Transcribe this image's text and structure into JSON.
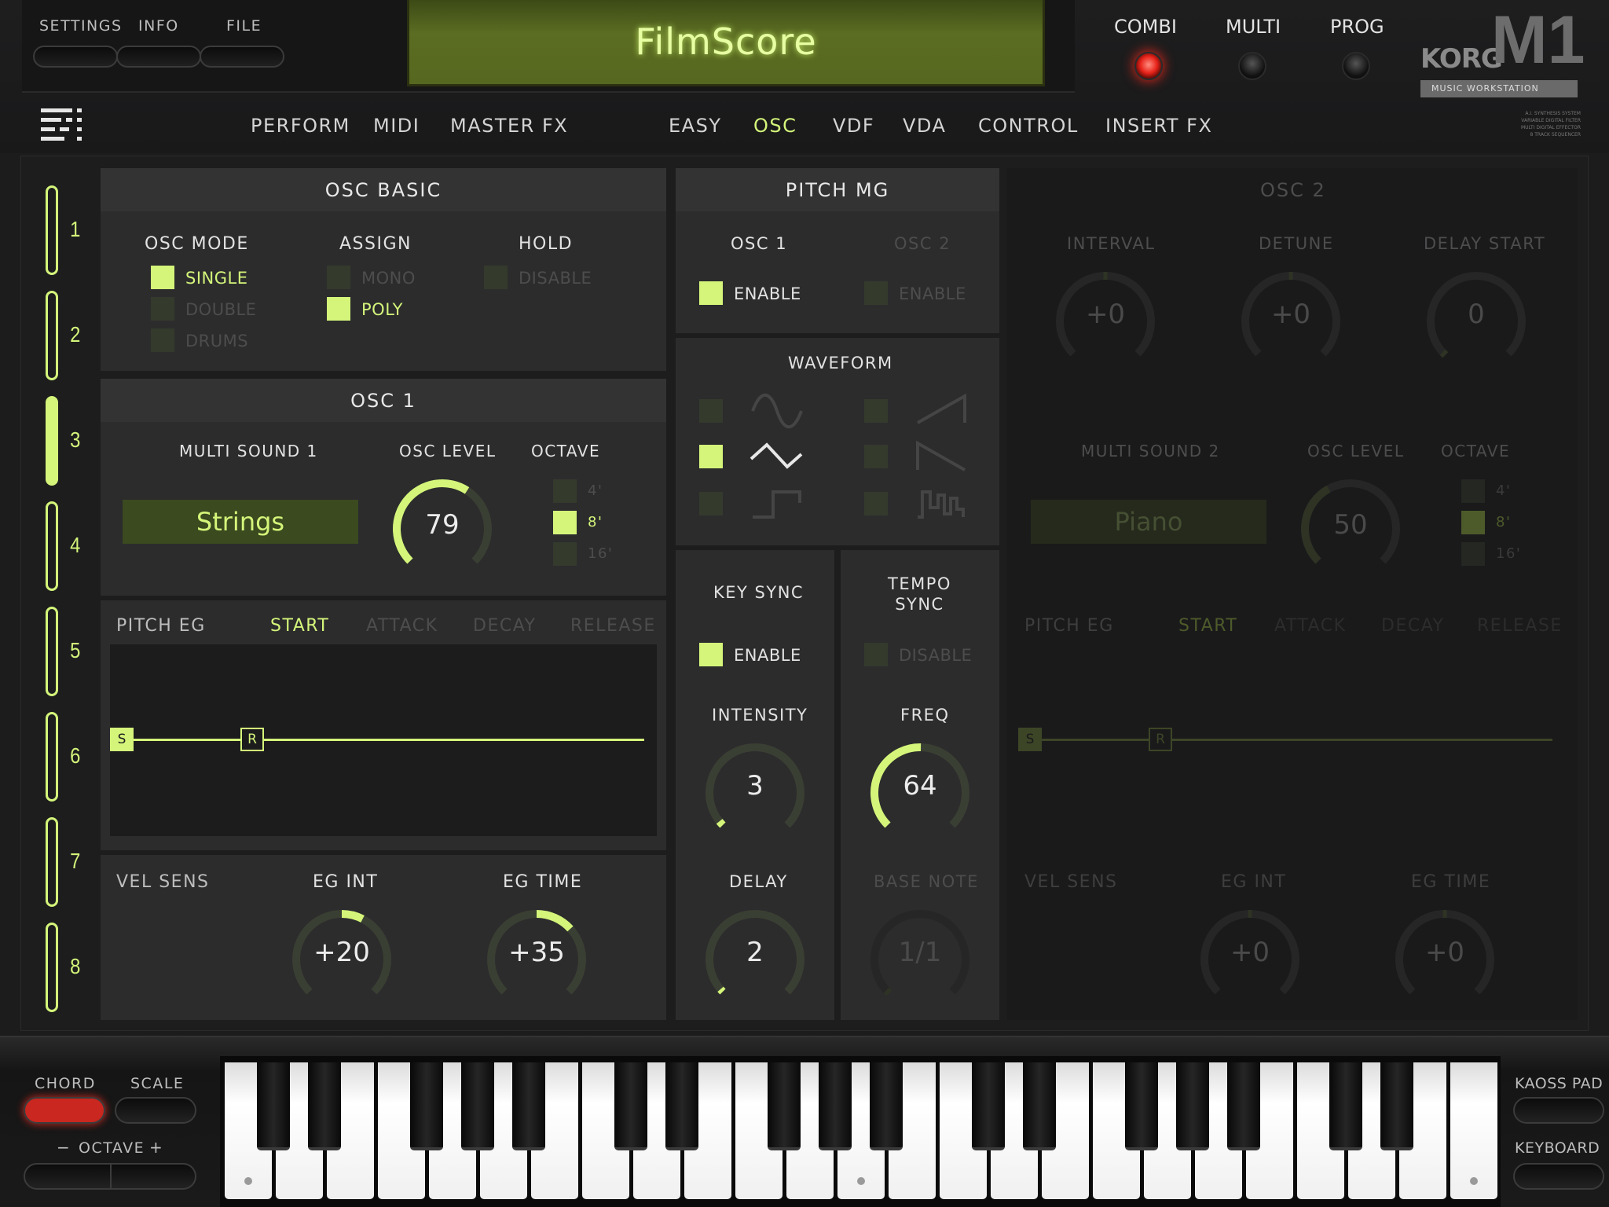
{
  "top_menu": [
    "SETTINGS",
    "INFO",
    "FILE"
  ],
  "display": {
    "program_name": "FilmScore"
  },
  "modes": [
    {
      "label": "COMBI",
      "active": true
    },
    {
      "label": "MULTI",
      "active": false
    },
    {
      "label": "PROG",
      "active": false
    }
  ],
  "logo": {
    "brand": "KORG",
    "model": "M1",
    "subtitle": "MUSIC WORKSTATION",
    "spec": [
      "A.I. SYNTHESIS SYSTEM",
      "VARIABLE DIGITAL FILTER",
      "MULTI DIGITAL EFFECTOR",
      "8 TRACK SEQUENCER"
    ]
  },
  "nav_left": [
    "PERFORM",
    "MIDI",
    "MASTER FX"
  ],
  "nav_right": [
    "EASY",
    "OSC",
    "VDF",
    "VDA",
    "CONTROL",
    "INSERT FX"
  ],
  "nav_active": "OSC",
  "slots": [
    "1",
    "2",
    "3",
    "4",
    "5",
    "6",
    "7",
    "8"
  ],
  "active_slot": 3,
  "osc_basic": {
    "title": "OSC BASIC",
    "osc_mode_label": "OSC MODE",
    "osc_mode_options": [
      "SINGLE",
      "DOUBLE",
      "DRUMS"
    ],
    "assign_label": "ASSIGN",
    "assign_options": [
      "MONO",
      "POLY"
    ],
    "hold_label": "HOLD",
    "hold_option": "DISABLE"
  },
  "osc1": {
    "title": "OSC 1",
    "multisound_label": "MULTI SOUND 1",
    "multisound_value": "Strings",
    "level_label": "OSC LEVEL",
    "level_value": 79,
    "octave_label": "OCTAVE",
    "octave_options": [
      "4'",
      "8'",
      "16'"
    ],
    "pitch_eg": {
      "label": "PITCH EG",
      "tabs": [
        "START",
        "ATTACK",
        "DECAY",
        "RELEASE"
      ],
      "nodes": [
        "S",
        "R"
      ]
    },
    "vel_sens_label": "VEL SENS",
    "eg_int_label": "EG INT",
    "eg_int_value": "+20",
    "eg_time_label": "EG TIME",
    "eg_time_value": "+35"
  },
  "pitch_mg": {
    "title": "PITCH MG",
    "osc1_label": "OSC 1",
    "osc1_enable": "ENABLE",
    "osc2_label": "OSC 2",
    "osc2_enable": "ENABLE",
    "waveform_label": "WAVEFORM",
    "key_sync_label": "KEY SYNC",
    "key_sync_value": "ENABLE",
    "tempo_sync_label": "TEMPO\nSYNC",
    "tempo_sync_value": "DISABLE",
    "intensity_label": "INTENSITY",
    "intensity_value": "3",
    "freq_label": "FREQ",
    "freq_value": "64",
    "delay_label": "DELAY",
    "delay_value": "2",
    "base_note_label": "BASE NOTE",
    "base_note_value": "1/1"
  },
  "osc2": {
    "title": "OSC 2",
    "interval_label": "INTERVAL",
    "interval_value": "+0",
    "detune_label": "DETUNE",
    "detune_value": "+0",
    "delay_start_label": "DELAY START",
    "delay_start_value": "0",
    "multisound_label": "MULTI SOUND 2",
    "multisound_value": "Piano",
    "level_label": "OSC LEVEL",
    "level_value": "50",
    "octave_label": "OCTAVE",
    "octave_options": [
      "4'",
      "8'",
      "16'"
    ],
    "pitch_eg": {
      "label": "PITCH EG",
      "tabs": [
        "START",
        "ATTACK",
        "DECAY",
        "RELEASE"
      ],
      "nodes": [
        "S",
        "R"
      ]
    },
    "vel_sens_label": "VEL SENS",
    "eg_int_label": "EG INT",
    "eg_int_value": "+0",
    "eg_time_label": "EG TIME",
    "eg_time_value": "+0"
  },
  "bottom": {
    "chord": "CHORD",
    "scale": "SCALE",
    "octave_minus": "−",
    "octave": "OCTAVE",
    "octave_plus": "+",
    "kaoss_pad": "KAOSS PAD",
    "keyboard": "KEYBOARD"
  },
  "colors": {
    "accent": "#d4f57a",
    "panel": "#2c2c2d",
    "led_red": "#e8231a"
  }
}
